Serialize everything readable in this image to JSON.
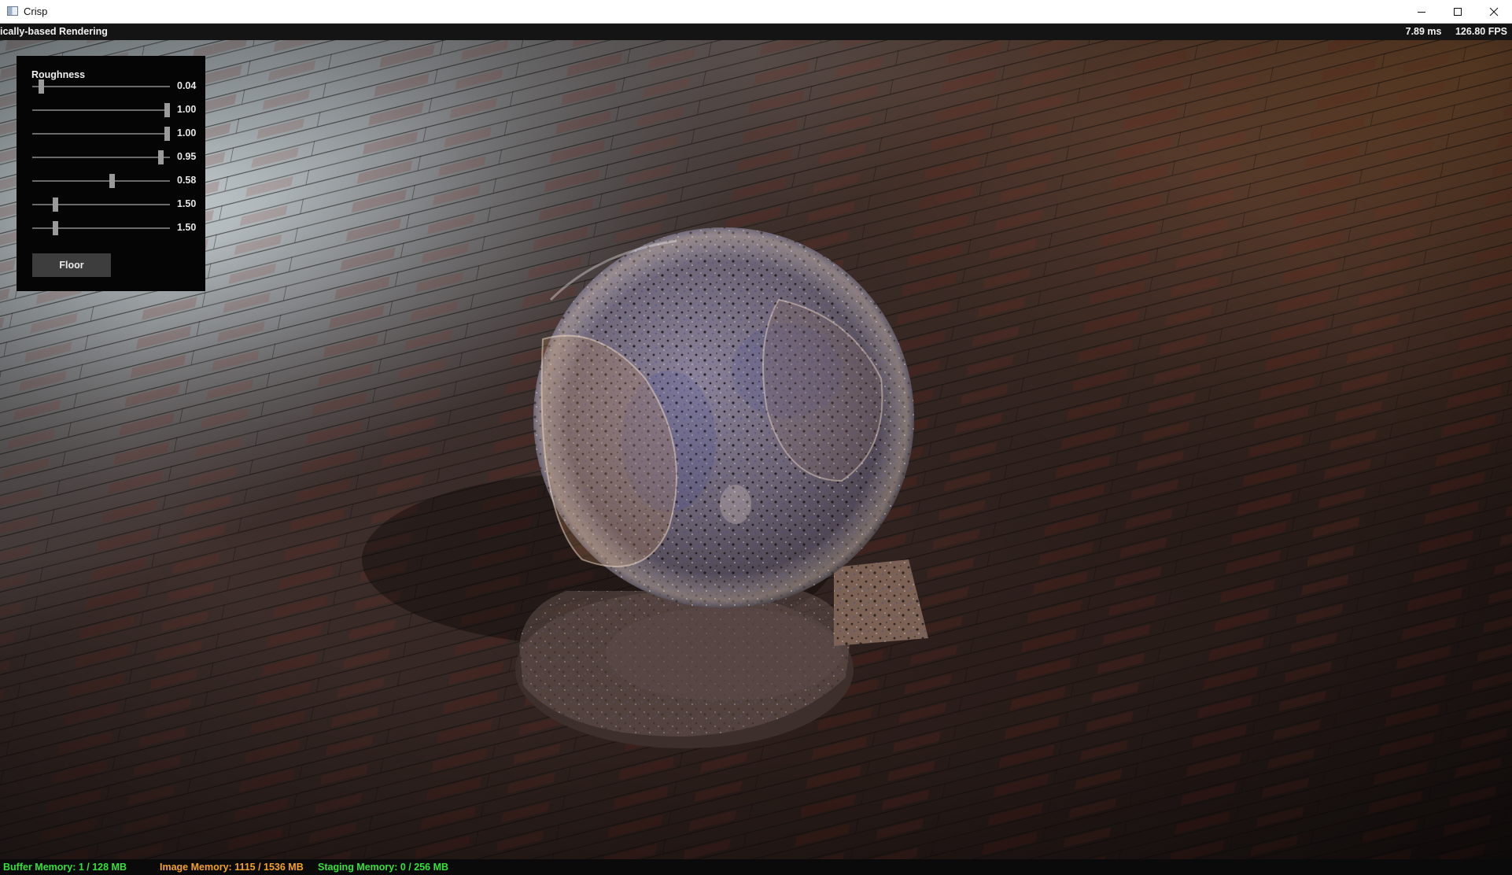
{
  "window": {
    "title": "Crisp",
    "icon": "app-window-icon",
    "controls": [
      "minimize-icon",
      "maximize-icon",
      "close-icon"
    ]
  },
  "overlay": {
    "label": "ically-based Rendering",
    "frame_time": "7.89 ms",
    "fps": "126.80 FPS"
  },
  "panel": {
    "title": "Roughness",
    "sliders": [
      {
        "value": 0.04,
        "label": "0.04"
      },
      {
        "value": 1.0,
        "label": "1.00"
      },
      {
        "value": 1.0,
        "label": "1.00"
      },
      {
        "value": 0.95,
        "label": "0.95"
      },
      {
        "value": 0.58,
        "label": "0.58"
      },
      {
        "value": 0.15,
        "label": "1.50"
      },
      {
        "value": 0.15,
        "label": "1.50"
      }
    ],
    "button": "Floor"
  },
  "status": {
    "buffer": "Buffer Memory: 1 / 128 MB",
    "image": "Image Memory: 1115 / 1536 MB",
    "staging": "Staging Memory: 0 / 256 MB",
    "colors": {
      "buffer": "#35e03a",
      "image": "#f3a226",
      "staging": "#35e03a"
    }
  }
}
